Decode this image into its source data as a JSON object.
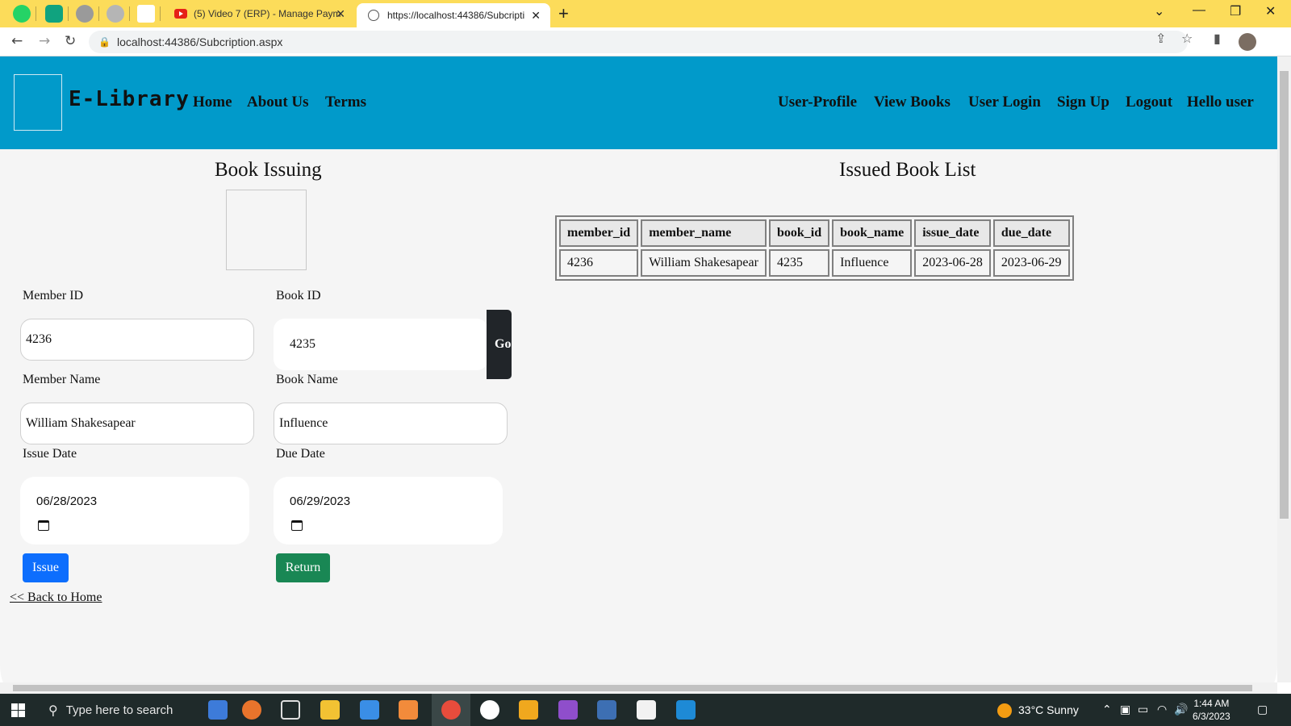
{
  "browser": {
    "tabs": [
      {
        "label": "(5) Video 7 (ERP) - Manage Paym",
        "close": "✕"
      },
      {
        "label": "https://localhost:44386/Subcripti",
        "close": "✕"
      }
    ],
    "new_tab": "+",
    "url": "localhost:44386/Subcription.aspx"
  },
  "site": {
    "brand": "E-Library",
    "nav_left": [
      "Home",
      "About Us",
      "Terms"
    ],
    "nav_right": [
      "User-Profile",
      "View Books",
      "User Login",
      "Sign Up",
      "Logout",
      "Hello user"
    ]
  },
  "issuing": {
    "title": "Book Issuing",
    "member_id_label": "Member ID",
    "member_id_value": "4236",
    "book_id_label": "Book ID",
    "book_id_value": "4235",
    "go_label": "Go",
    "member_name_label": "Member Name",
    "member_name_value": "William Shakesapear",
    "book_name_label": "Book Name",
    "book_name_value": "Influence",
    "issue_date_label": "Issue Date",
    "issue_date_value": "06/28/2023",
    "due_date_label": "Due Date",
    "due_date_value": "06/29/2023",
    "issue_button": "Issue",
    "return_button": "Return",
    "back_link": "<< Back to Home"
  },
  "issued_list": {
    "title": "Issued Book List",
    "columns": [
      "member_id",
      "member_name",
      "book_id",
      "book_name",
      "issue_date",
      "due_date"
    ],
    "rows": [
      [
        "4236",
        "William Shakesapear",
        "4235",
        "Influence",
        "2023-06-28",
        "2023-06-29"
      ]
    ]
  },
  "taskbar": {
    "search_placeholder": "Type here to search",
    "weather": "33°C  Sunny",
    "time": "1:44 AM",
    "date": "6/3/2023"
  },
  "colors": {
    "header": "#019aca",
    "tab_bar": "#fcdc5a",
    "issue_button": "#0d6efd",
    "return_button": "#198754",
    "go_button": "#212529"
  }
}
